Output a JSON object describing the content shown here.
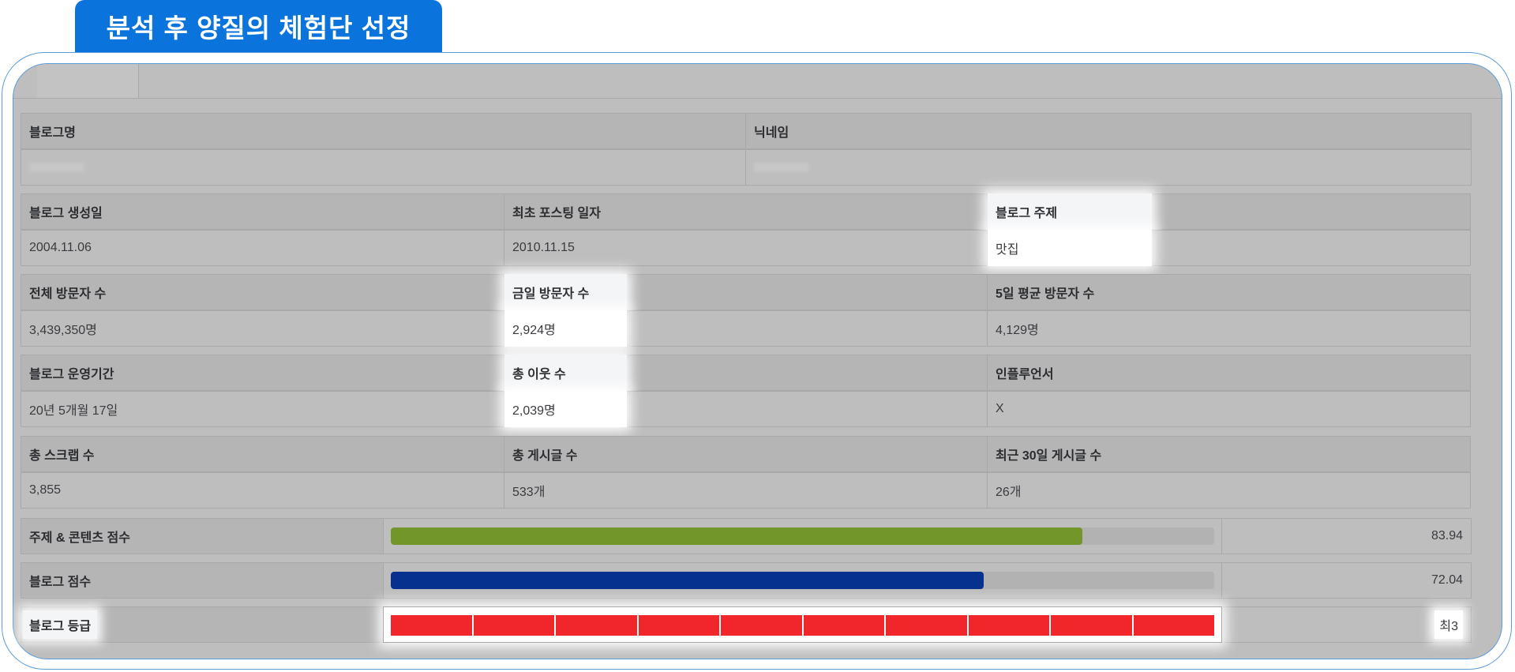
{
  "banner": {
    "title": "분석 후 양질의 체험단 선정"
  },
  "profile": {
    "blog_name_label": "블로그명",
    "nickname_label": "닉네임"
  },
  "stats_rows": [
    {
      "cells": [
        {
          "label": "블로그 생성일",
          "value": "2004.11.06"
        },
        {
          "label": "최초 포스팅 일자",
          "value": "2010.11.15"
        },
        {
          "label": "블로그 주제",
          "value": "맛집"
        }
      ]
    },
    {
      "cells": [
        {
          "label": "전체 방문자 수",
          "value": "3,439,350명"
        },
        {
          "label": "금일 방문자 수",
          "value": "2,924명"
        },
        {
          "label": "5일 평균 방문자 수",
          "value": "4,129명"
        }
      ]
    },
    {
      "cells": [
        {
          "label": "블로그 운영기간",
          "value": "20년 5개월 17일"
        },
        {
          "label": "총 이웃 수",
          "value": "2,039명"
        },
        {
          "label": "인플루언서",
          "value": "X"
        }
      ]
    },
    {
      "cells": [
        {
          "label": "총 스크랩 수",
          "value": "3,855"
        },
        {
          "label": "총 게시글 수",
          "value": "533개"
        },
        {
          "label": "최근 30일 게시글 수",
          "value": "26개"
        }
      ]
    }
  ],
  "scores": [
    {
      "label": "주제 & 콘텐츠 점수",
      "value": "83.94",
      "fill_percent": 84,
      "color": "#72962a"
    },
    {
      "label": "블로그 점수",
      "value": "72.04",
      "fill_percent": 72,
      "color": "#06318f"
    }
  ],
  "grade": {
    "label": "블로그 등급",
    "value": "최3",
    "segments_filled": 10,
    "segments_total": 10,
    "color": "#f0262b"
  },
  "colors": {
    "banner": "#0a74dc",
    "frame": "#5b9bd8",
    "panel": "#bebebe",
    "highlight": "#ffffff"
  }
}
